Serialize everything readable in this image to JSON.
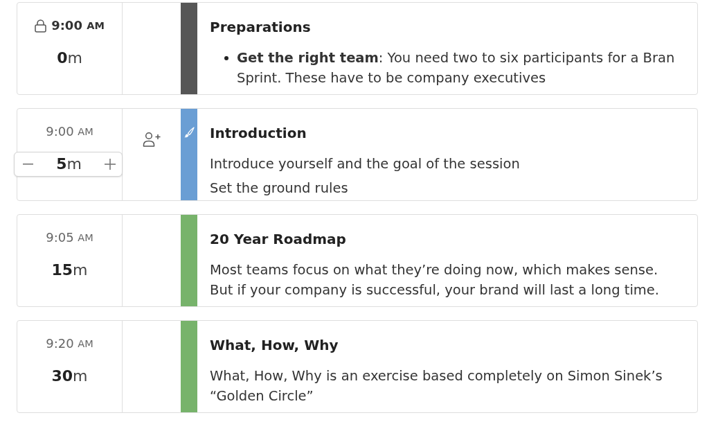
{
  "agenda_items": [
    {
      "locked": true,
      "hovered": false,
      "time": "9:00",
      "period": "AM",
      "duration": "0",
      "unit": "m",
      "color": "#565656",
      "title": "Preparations",
      "kind": "bullets",
      "body": [
        "**Get the right team**: You need two to six participants for a Bran Sprint. These have to be company executives"
      ]
    },
    {
      "locked": false,
      "hovered": true,
      "time": "9:00",
      "period": "AM",
      "duration": "5",
      "unit": "m",
      "color": "#6a9ed4",
      "title": "Introduction",
      "kind": "paragraphs",
      "body": [
        "Introduce yourself and the goal of the session",
        "Set the ground rules"
      ]
    },
    {
      "locked": false,
      "hovered": false,
      "time": "9:05",
      "period": "AM",
      "duration": "15",
      "unit": "m",
      "color": "#77b36b",
      "title": "20 Year Roadmap",
      "kind": "paragraphs",
      "body": [
        "Most teams focus on what they’re doing now, which makes sense. But if your company is successful, your brand will last a long time."
      ]
    },
    {
      "locked": false,
      "hovered": false,
      "time": "9:20",
      "period": "AM",
      "duration": "30",
      "unit": "m",
      "color": "#77b36b",
      "title": "What, How, Why",
      "kind": "paragraphs",
      "body": [
        "What, How, Why is an exercise based completely on Simon Sinek’s “Golden Circle”"
      ]
    }
  ]
}
